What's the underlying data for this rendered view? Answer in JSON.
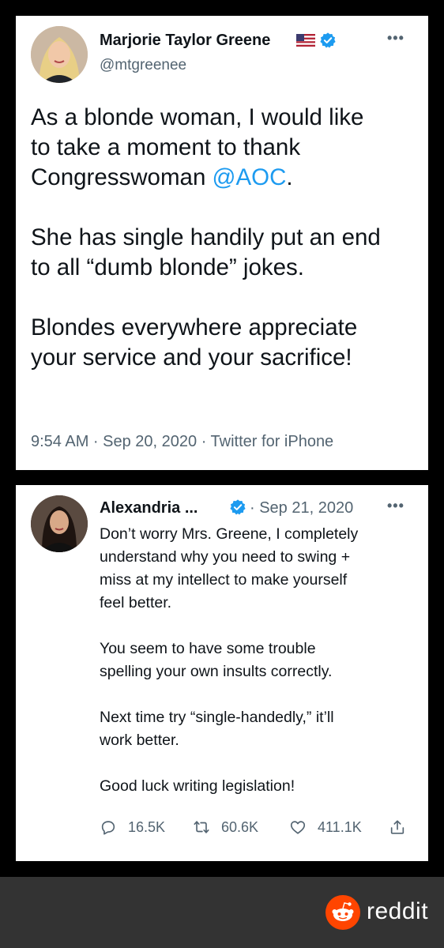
{
  "tweet1": {
    "name": "Marjorie Taylor Greene",
    "handle": "@mtgreenee",
    "body_part1": "As a blonde woman, I would like\nto take a moment to thank\nCongresswoman ",
    "mention": "@AOC",
    "body_part1_end": ".",
    "body_para2": "She has single handily put an end\nto all “dumb blonde” jokes.",
    "body_para3": "Blondes everywhere appreciate\nyour service and your sacrifice!",
    "meta": "9:54 AM · Sep 20, 2020 · Twitter for iPhone",
    "more_icon": "more-icon",
    "flag_icon": "us-flag-icon",
    "verified_icon": "verified-badge-icon"
  },
  "tweet2": {
    "name": "Alexandria ...",
    "date": "· Sep 21, 2020",
    "paragraphs": [
      "Don’t worry Mrs. Greene, I completely\nunderstand why you need to swing +\nmiss at my intellect to make yourself\nfeel better.",
      "You seem to have some trouble\nspelling your own insults correctly.",
      "Next time try “single-handedly,” it’ll\nwork better.",
      "Good luck writing legislation!"
    ],
    "actions": {
      "replies": "16.5K",
      "retweets": "60.6K",
      "likes": "411.1K"
    }
  },
  "footer": {
    "brand": "reddit"
  },
  "colors": {
    "twitter_blue": "#1d9bf0",
    "secondary_text": "#536471",
    "reddit_orange": "#ff4500",
    "footer_bg": "#333333"
  }
}
